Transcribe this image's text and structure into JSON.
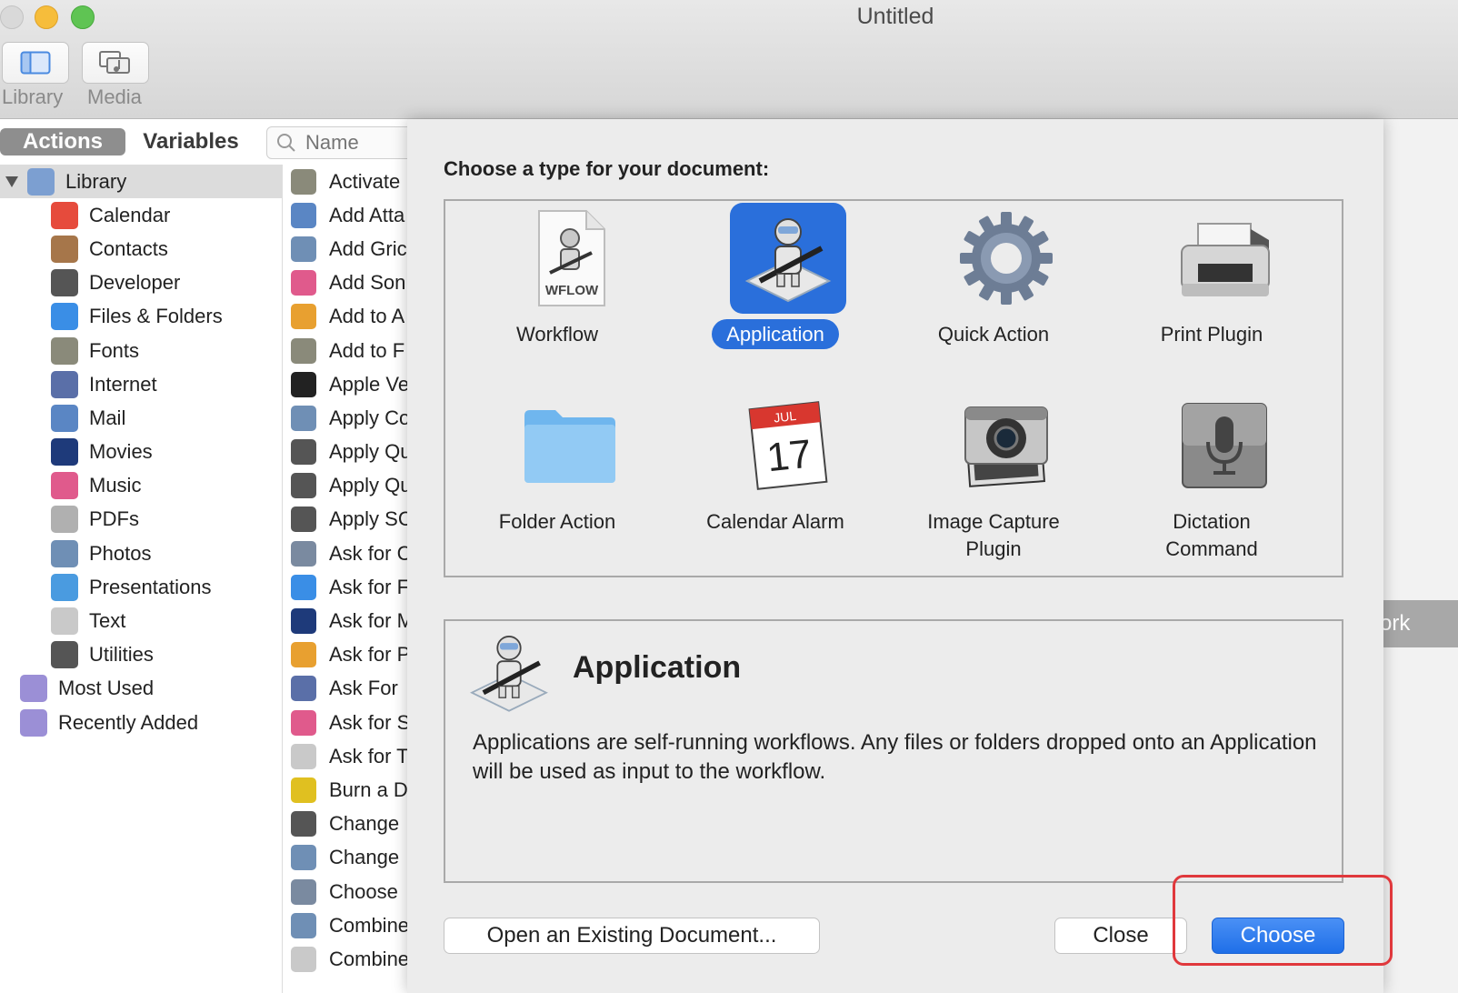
{
  "window": {
    "title": "Untitled"
  },
  "toolbar": {
    "library_label": "Library",
    "media_label": "Media"
  },
  "library_pane": {
    "tabs": {
      "actions": "Actions",
      "variables": "Variables"
    },
    "search_placeholder": "Name",
    "categories": [
      {
        "label": "Library",
        "icon": "library-icon",
        "color": "#7c9fd1"
      },
      {
        "label": "Calendar",
        "icon": "calendar-icon",
        "color": "#e64b3c"
      },
      {
        "label": "Contacts",
        "icon": "contacts-icon",
        "color": "#a6764a"
      },
      {
        "label": "Developer",
        "icon": "developer-icon",
        "color": "#555555"
      },
      {
        "label": "Files & Folders",
        "icon": "finder-icon",
        "color": "#3a8ee6"
      },
      {
        "label": "Fonts",
        "icon": "fonts-icon",
        "color": "#8a8a7a"
      },
      {
        "label": "Internet",
        "icon": "internet-icon",
        "color": "#5a6fa8"
      },
      {
        "label": "Mail",
        "icon": "mail-icon",
        "color": "#5a86c4"
      },
      {
        "label": "Movies",
        "icon": "movies-icon",
        "color": "#1e3a7a"
      },
      {
        "label": "Music",
        "icon": "music-icon",
        "color": "#e05a8c"
      },
      {
        "label": "PDFs",
        "icon": "pdf-icon",
        "color": "#b0b0b0"
      },
      {
        "label": "Photos",
        "icon": "photos-icon",
        "color": "#6f8fb5"
      },
      {
        "label": "Presentations",
        "icon": "presentation-icon",
        "color": "#4a9be0"
      },
      {
        "label": "Text",
        "icon": "text-icon",
        "color": "#c9c9c9"
      },
      {
        "label": "Utilities",
        "icon": "utilities-icon",
        "color": "#555555"
      },
      {
        "label": "Most Used",
        "icon": "smart-folder-icon",
        "color": "#9b8fd6"
      },
      {
        "label": "Recently Added",
        "icon": "smart-folder-icon",
        "color": "#9b8fd6"
      }
    ],
    "actions": [
      {
        "label": "Activate",
        "icon": "fonts-icon",
        "color": "#8a8a7a"
      },
      {
        "label": "Add Atta",
        "icon": "mail-icon",
        "color": "#5a86c4"
      },
      {
        "label": "Add Gric",
        "icon": "photos-icon",
        "color": "#6f8fb5"
      },
      {
        "label": "Add Son",
        "icon": "music-icon",
        "color": "#e05a8c"
      },
      {
        "label": "Add to A",
        "icon": "photos-app-icon",
        "color": "#e8a030"
      },
      {
        "label": "Add to F",
        "icon": "fonts-icon",
        "color": "#8a8a7a"
      },
      {
        "label": "Apple Ve",
        "icon": "terminal-icon",
        "color": "#222222"
      },
      {
        "label": "Apply Co",
        "icon": "photos-icon",
        "color": "#6f8fb5"
      },
      {
        "label": "Apply Qu",
        "icon": "utilities-icon",
        "color": "#555555"
      },
      {
        "label": "Apply Qu",
        "icon": "utilities-icon",
        "color": "#555555"
      },
      {
        "label": "Apply SC",
        "icon": "utilities-icon",
        "color": "#555555"
      },
      {
        "label": "Ask for C",
        "icon": "automator-icon",
        "color": "#7a8aa0"
      },
      {
        "label": "Ask for F",
        "icon": "finder-icon",
        "color": "#3a8ee6"
      },
      {
        "label": "Ask for M",
        "icon": "movies-icon",
        "color": "#1e3a7a"
      },
      {
        "label": "Ask for P",
        "icon": "photos-app-icon",
        "color": "#e8a030"
      },
      {
        "label": "Ask For",
        "icon": "internet-icon",
        "color": "#5a6fa8"
      },
      {
        "label": "Ask for S",
        "icon": "music-icon",
        "color": "#e05a8c"
      },
      {
        "label": "Ask for T",
        "icon": "text-icon",
        "color": "#c9c9c9"
      },
      {
        "label": "Burn a D",
        "icon": "burn-icon",
        "color": "#e0c020"
      },
      {
        "label": "Change",
        "icon": "settings-icon",
        "color": "#555555"
      },
      {
        "label": "Change",
        "icon": "photos-icon",
        "color": "#6f8fb5"
      },
      {
        "label": "Choose",
        "icon": "automator-icon",
        "color": "#7a8aa0"
      },
      {
        "label": "Combine",
        "icon": "photos-icon",
        "color": "#6f8fb5"
      },
      {
        "label": "Combine",
        "icon": "text-icon",
        "color": "#c9c9c9"
      }
    ]
  },
  "sheet": {
    "title": "Choose a type for your document:",
    "types": [
      {
        "label": "Workflow",
        "icon": "workflow-file-icon",
        "badge": "WFLOW"
      },
      {
        "label": "Application",
        "icon": "automator-robot-icon",
        "selected": true
      },
      {
        "label": "Quick Action",
        "icon": "gear-icon"
      },
      {
        "label": "Print Plugin",
        "icon": "printer-icon"
      },
      {
        "label": "Folder Action",
        "icon": "folder-icon"
      },
      {
        "label": "Calendar Alarm",
        "icon": "calendar-icon",
        "month": "JUL",
        "day": "17"
      },
      {
        "label": "Image Capture Plugin",
        "icon": "camera-icon"
      },
      {
        "label": "Dictation Command",
        "icon": "microphone-icon"
      }
    ],
    "description": {
      "title": "Application",
      "text": "Applications are self-running workflows. Any files or folders dropped onto an Application will be used as input to the workflow."
    },
    "buttons": {
      "open": "Open an Existing Document...",
      "close": "Close",
      "choose": "Choose"
    }
  },
  "background_hint": "r work",
  "colors": {
    "accent": "#2a6fdb",
    "highlight": "#e0383c"
  }
}
